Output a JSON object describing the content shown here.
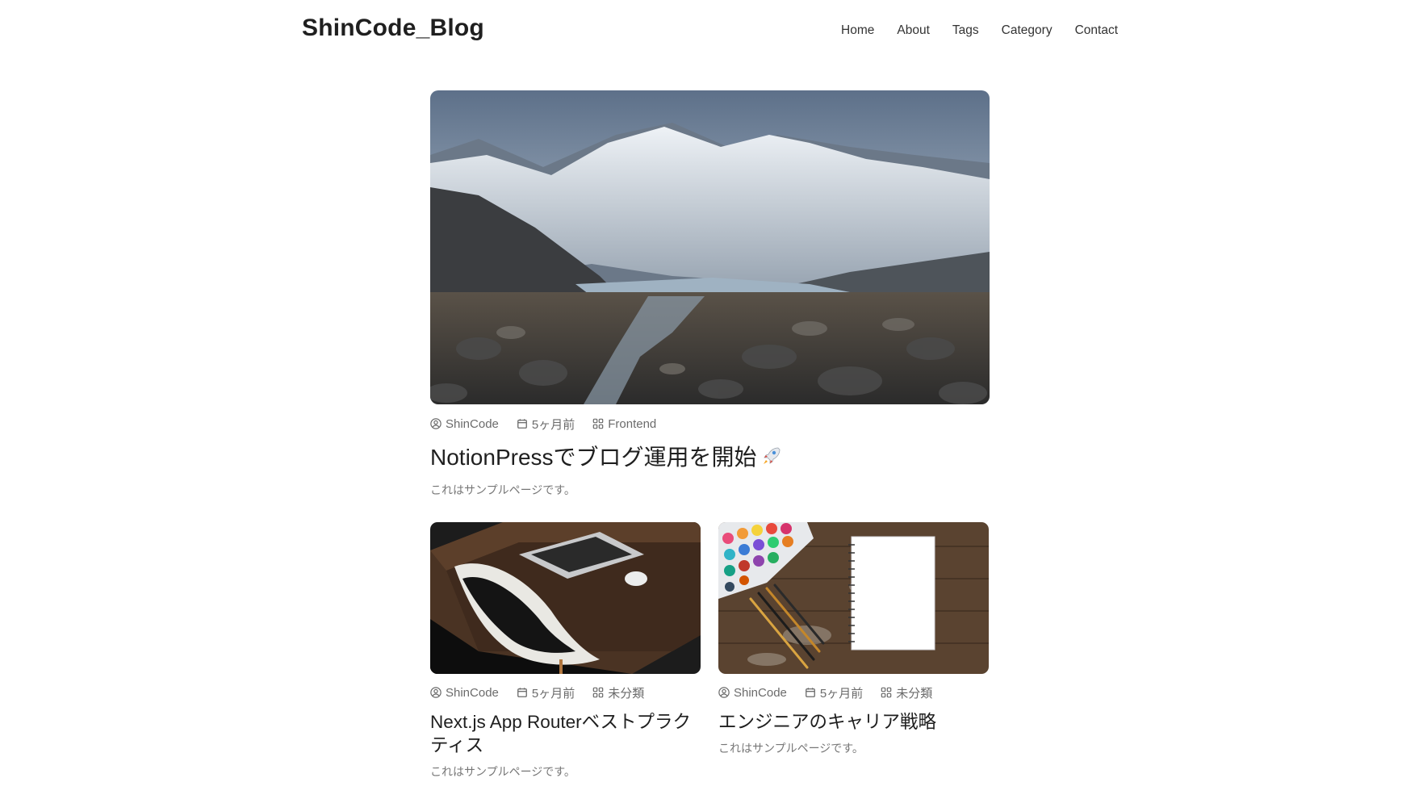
{
  "header": {
    "logo": "ShinCode_Blog",
    "nav": [
      "Home",
      "About",
      "Tags",
      "Category",
      "Contact"
    ]
  },
  "featured": {
    "author": "ShinCode",
    "date": "5ヶ月前",
    "category": "Frontend",
    "title": "NotionPressでブログ運用を開始",
    "title_emoji": "rocket-icon",
    "description": "これはサンプルページです。"
  },
  "posts": [
    {
      "author": "ShinCode",
      "date": "5ヶ月前",
      "category": "未分類",
      "title": "Next.js App Routerベストプラクティス",
      "description": "これはサンプルページです。"
    },
    {
      "author": "ShinCode",
      "date": "5ヶ月前",
      "category": "未分類",
      "title": "エンジニアのキャリア戦略",
      "description": "これはサンプルページです。"
    }
  ],
  "icons": {
    "author": "user-circle-icon",
    "date": "calendar-icon",
    "category": "grid-icon"
  }
}
